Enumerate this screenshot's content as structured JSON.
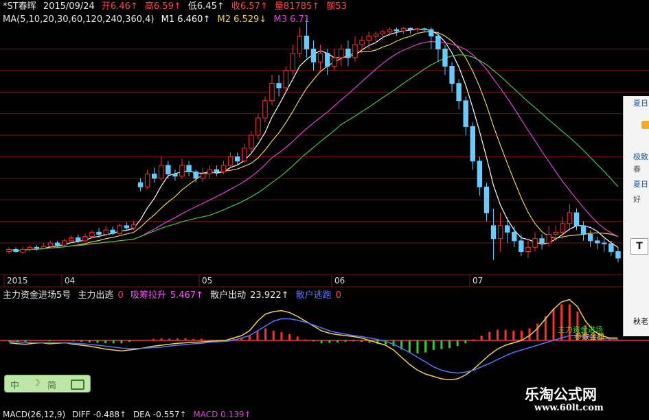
{
  "header": {
    "symbol": "*ST春晖",
    "date": "2015/09/24",
    "open": "开6.46↑",
    "high": "高6.59↑",
    "low": "低6.45↑",
    "close": "收6.57↑",
    "volume": "量81785↑",
    "amount": "额53"
  },
  "ma_line": {
    "params": "MA(5,10,20,30,60,120,240,360,4)",
    "m1": "M1 6.460↑",
    "m2": "M2 6.529↓",
    "m3": "M3 6.71"
  },
  "indicator": {
    "name": "主力资金进场5号",
    "chu_label": "主力出逃",
    "chu_value": "0",
    "xi_label": "吸筹拉升",
    "xi_value": "5.467↑",
    "san_label": "散户出动",
    "san_value": "23.922↑",
    "tao_label": "散户逃跑",
    "tao_value": "0"
  },
  "macd_line": {
    "params": "MACD(26,12,9)",
    "diff": "DIFF -0.488↑",
    "dea": "DEA -0.557↑",
    "macd": "MACD 0.139↑"
  },
  "overlay_text": {
    "a": "主力资金进场",
    "b": "参数金额"
  },
  "side_panel": {
    "items": [
      "夏日",
      "极致",
      "春",
      "夏日",
      "好"
    ],
    "t_button": "T",
    "bottom": "秋老"
  },
  "watermark": {
    "title": "乐淘公式网",
    "url": "www.60lt.com"
  },
  "zoom_button": {
    "a": "中",
    "b": "简"
  },
  "colors": {
    "up": "#ff3030",
    "down": "#66ccff",
    "ma1": "#ffffff",
    "ma2": "#f2d24a",
    "ma3": "#e040e0",
    "ma4": "#3ec84a",
    "grid": "#7a0f0f",
    "diff": "#f2d24a",
    "dea": "#ff77cc"
  },
  "chart_data": {
    "type": "candlestick",
    "x_labels": [
      "2015",
      "04",
      "05",
      "06",
      "07"
    ],
    "price_lines": [
      6.5,
      7.0,
      7.5,
      8.0,
      8.5,
      9.0,
      9.5,
      10.0,
      10.5,
      11.0
    ],
    "candles": [
      [
        6.3,
        6.35,
        6.25,
        6.4
      ],
      [
        6.35,
        6.3,
        6.28,
        6.4
      ],
      [
        6.28,
        6.35,
        6.25,
        6.42
      ],
      [
        6.35,
        6.4,
        6.3,
        6.45
      ],
      [
        6.4,
        6.38,
        6.32,
        6.45
      ],
      [
        6.38,
        6.42,
        6.35,
        6.5
      ],
      [
        6.42,
        6.5,
        6.38,
        6.55
      ],
      [
        6.5,
        6.45,
        6.4,
        6.55
      ],
      [
        6.45,
        6.55,
        6.42,
        6.6
      ],
      [
        6.55,
        6.62,
        6.5,
        6.68
      ],
      [
        6.62,
        6.55,
        6.5,
        6.7
      ],
      [
        6.55,
        6.65,
        6.52,
        6.72
      ],
      [
        6.65,
        6.75,
        6.6,
        6.8
      ],
      [
        6.75,
        6.7,
        6.62,
        6.85
      ],
      [
        6.7,
        6.8,
        6.65,
        6.9
      ],
      [
        6.8,
        6.72,
        6.68,
        6.88
      ],
      [
        6.72,
        6.9,
        6.7,
        6.95
      ],
      [
        6.9,
        6.85,
        6.78,
        6.98
      ],
      [
        6.85,
        6.92,
        6.8,
        7.0
      ],
      [
        7.9,
        7.8,
        7.7,
        8.0
      ],
      [
        7.8,
        8.1,
        7.75,
        8.2
      ],
      [
        8.1,
        8.0,
        7.9,
        8.25
      ],
      [
        8.0,
        8.3,
        7.95,
        8.5
      ],
      [
        8.3,
        8.1,
        8.0,
        8.4
      ],
      [
        8.1,
        8.05,
        7.95,
        8.2
      ],
      [
        8.05,
        8.3,
        8.0,
        8.45
      ],
      [
        8.3,
        8.15,
        8.05,
        8.4
      ],
      [
        8.15,
        8.0,
        7.9,
        8.2
      ],
      [
        8.0,
        8.1,
        7.92,
        8.25
      ],
      [
        8.1,
        8.2,
        8.0,
        8.3
      ],
      [
        8.2,
        8.15,
        8.05,
        8.3
      ],
      [
        8.15,
        8.3,
        8.1,
        8.4
      ],
      [
        8.3,
        8.5,
        8.25,
        8.6
      ],
      [
        8.5,
        8.4,
        8.3,
        8.6
      ],
      [
        8.4,
        8.7,
        8.35,
        8.8
      ],
      [
        8.7,
        9.0,
        8.6,
        9.1
      ],
      [
        9.0,
        9.4,
        8.9,
        9.5
      ],
      [
        9.4,
        9.8,
        9.3,
        9.9
      ],
      [
        9.8,
        10.2,
        9.7,
        10.4
      ],
      [
        10.2,
        10.1,
        9.9,
        10.4
      ],
      [
        10.1,
        10.5,
        10.0,
        10.6
      ],
      [
        10.5,
        10.9,
        10.4,
        11.1
      ],
      [
        10.9,
        11.3,
        10.8,
        11.5
      ],
      [
        11.3,
        11.0,
        10.8,
        11.7
      ],
      [
        11.0,
        10.7,
        10.5,
        11.2
      ],
      [
        10.7,
        10.9,
        10.5,
        11.1
      ],
      [
        10.9,
        10.6,
        10.4,
        11.0
      ],
      [
        10.6,
        10.8,
        10.5,
        11.0
      ],
      [
        10.8,
        11.0,
        10.6,
        11.1
      ],
      [
        11.0,
        10.8,
        10.6,
        11.2
      ],
      [
        10.8,
        11.1,
        10.7,
        11.3
      ],
      [
        11.1,
        11.2,
        10.9,
        11.3
      ],
      [
        11.2,
        11.3,
        11.0,
        11.4
      ],
      [
        11.3,
        11.35,
        11.1,
        11.4
      ],
      [
        11.35,
        11.4,
        11.2,
        11.45
      ],
      [
        11.4,
        11.45,
        11.3,
        11.5
      ],
      [
        11.45,
        11.42,
        11.3,
        11.5
      ],
      [
        11.42,
        11.48,
        11.35,
        11.5
      ],
      [
        11.48,
        11.45,
        11.35,
        11.5
      ],
      [
        11.45,
        11.47,
        11.35,
        11.5
      ],
      [
        11.47,
        11.45,
        11.38,
        11.5
      ],
      [
        11.45,
        11.3,
        11.0,
        11.5
      ],
      [
        11.3,
        11.0,
        10.7,
        11.4
      ],
      [
        11.0,
        10.6,
        10.4,
        11.1
      ],
      [
        10.6,
        10.2,
        10.0,
        10.7
      ],
      [
        10.2,
        9.8,
        9.6,
        10.3
      ],
      [
        9.8,
        9.2,
        9.0,
        9.9
      ],
      [
        9.2,
        8.4,
        8.2,
        9.3
      ],
      [
        8.4,
        7.8,
        7.6,
        8.5
      ],
      [
        7.8,
        7.2,
        7.0,
        7.9
      ],
      [
        6.9,
        6.6,
        6.1,
        7.3
      ],
      [
        6.6,
        6.9,
        6.3,
        7.2
      ],
      [
        6.9,
        6.75,
        6.5,
        7.1
      ],
      [
        6.75,
        6.55,
        6.4,
        6.9
      ],
      [
        6.55,
        6.3,
        6.2,
        6.7
      ],
      [
        6.3,
        6.4,
        6.15,
        6.6
      ],
      [
        6.4,
        6.6,
        6.3,
        6.75
      ],
      [
        6.6,
        6.5,
        6.35,
        6.7
      ],
      [
        6.5,
        6.7,
        6.4,
        6.9
      ],
      [
        6.7,
        6.75,
        6.55,
        6.9
      ],
      [
        6.75,
        6.95,
        6.6,
        7.1
      ],
      [
        6.95,
        7.2,
        6.85,
        7.4
      ],
      [
        7.2,
        6.9,
        6.8,
        7.3
      ],
      [
        6.9,
        6.7,
        6.55,
        7.0
      ],
      [
        6.7,
        6.55,
        6.4,
        6.8
      ],
      [
        6.55,
        6.5,
        6.35,
        6.65
      ],
      [
        6.5,
        6.48,
        6.3,
        6.6
      ],
      [
        6.48,
        6.3,
        6.2,
        6.55
      ],
      [
        6.3,
        6.15,
        6.05,
        6.4
      ]
    ],
    "diff": [
      -0.05,
      -0.07,
      -0.08,
      -0.06,
      -0.05,
      -0.07,
      -0.06,
      -0.05,
      -0.08,
      -0.1,
      -0.12,
      -0.15,
      -0.18,
      -0.2,
      -0.22,
      -0.2,
      -0.18,
      -0.15,
      -0.12,
      -0.1,
      -0.08,
      -0.06,
      -0.05,
      -0.04,
      -0.03,
      -0.02,
      -0.01,
      0.0,
      0.05,
      0.1,
      0.2,
      0.4,
      0.55,
      0.6,
      0.62,
      0.58,
      0.5,
      0.4,
      0.3,
      0.2,
      0.15,
      0.12,
      0.1,
      0.08,
      0.05,
      0.0,
      -0.05,
      -0.1,
      -0.2,
      -0.35,
      -0.5,
      -0.62,
      -0.7,
      -0.75,
      -0.8,
      -0.82,
      -0.8,
      -0.72,
      -0.6,
      -0.45,
      -0.3,
      -0.18,
      -0.1,
      -0.05,
      0.0,
      0.1,
      0.25,
      0.45,
      0.65,
      0.8,
      0.85,
      0.7,
      0.4,
      0.2,
      0.1,
      0.05,
      0.05
    ],
    "dea": [
      -0.02,
      -0.03,
      -0.04,
      -0.05,
      -0.05,
      -0.05,
      -0.05,
      -0.05,
      -0.06,
      -0.07,
      -0.08,
      -0.1,
      -0.12,
      -0.14,
      -0.16,
      -0.17,
      -0.17,
      -0.16,
      -0.15,
      -0.14,
      -0.12,
      -0.1,
      -0.09,
      -0.07,
      -0.06,
      -0.04,
      -0.03,
      -0.02,
      0.0,
      0.05,
      0.1,
      0.2,
      0.3,
      0.4,
      0.45,
      0.45,
      0.42,
      0.38,
      0.32,
      0.26,
      0.2,
      0.16,
      0.13,
      0.1,
      0.08,
      0.05,
      0.02,
      -0.02,
      -0.08,
      -0.16,
      -0.25,
      -0.35,
      -0.45,
      -0.55,
      -0.62,
      -0.66,
      -0.68,
      -0.66,
      -0.62,
      -0.55,
      -0.48,
      -0.4,
      -0.32,
      -0.25,
      -0.2,
      -0.15,
      -0.1,
      -0.05,
      0.0,
      0.05,
      0.1,
      0.1,
      0.08,
      0.06,
      0.04,
      0.03,
      0.03
    ],
    "ylim": [
      5.8,
      11.5
    ]
  }
}
